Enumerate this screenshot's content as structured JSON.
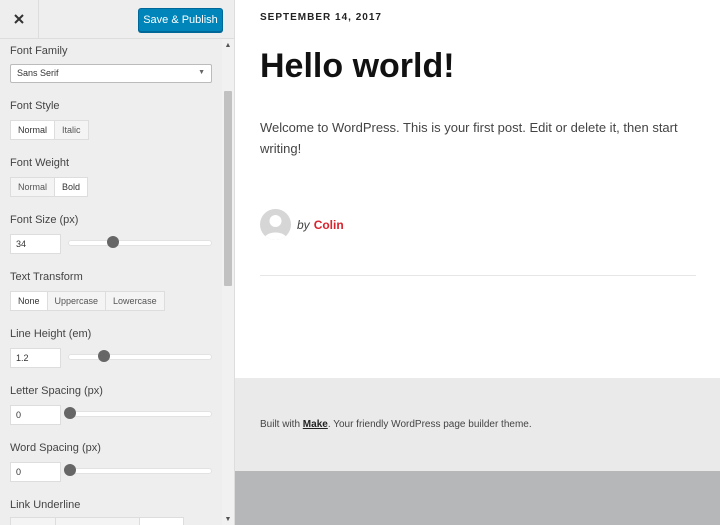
{
  "topbar": {
    "publish_label": "Save & Publish"
  },
  "controls": {
    "font_family": {
      "label": "Font Family",
      "value": "Sans Serif"
    },
    "font_style": {
      "label": "Font Style",
      "options": [
        "Normal",
        "Italic"
      ],
      "selected": "Normal"
    },
    "font_weight": {
      "label": "Font Weight",
      "options": [
        "Normal",
        "Bold"
      ],
      "selected": "Bold"
    },
    "font_size": {
      "label": "Font Size (px)",
      "value": "34"
    },
    "text_transform": {
      "label": "Text Transform",
      "options": [
        "None",
        "Uppercase",
        "Lowercase"
      ],
      "selected": "None"
    },
    "line_height": {
      "label": "Line Height (em)",
      "value": "1.2"
    },
    "letter_spacing": {
      "label": "Letter Spacing (px)",
      "value": "0"
    },
    "word_spacing": {
      "label": "Word Spacing (px)",
      "value": "0"
    },
    "link_underline": {
      "label": "Link Underline"
    }
  },
  "preview": {
    "date": "SEPTEMBER 14, 2017",
    "title": "Hello world!",
    "body": "Welcome to WordPress. This is your first post. Edit or delete it, then start writing!",
    "by": "by",
    "author": "Colin",
    "footer_prefix": "Built with ",
    "footer_link": "Make",
    "footer_suffix": ". Your friendly WordPress page builder theme."
  }
}
